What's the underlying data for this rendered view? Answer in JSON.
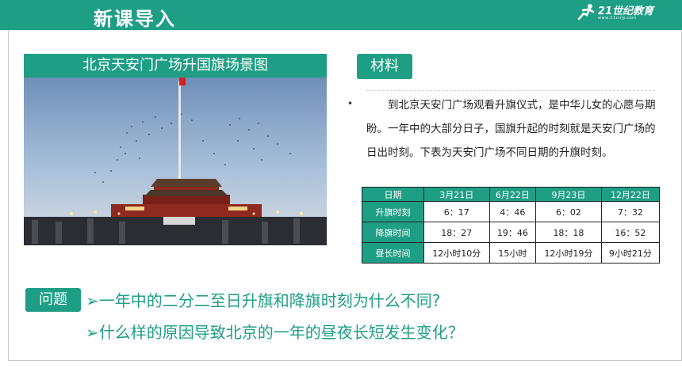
{
  "header": {
    "title": "新课导入",
    "logo_text": "21世纪教育",
    "logo_sub": "www.21cnjy.com"
  },
  "image_panel": {
    "title": "北京天安门广场升国旗场景图"
  },
  "material": {
    "tag": "材料",
    "bullet": "•",
    "text": "到北京天安门广场观看升旗仪式，是中华儿女的心愿与期盼。一年中的大部分日子，国旗升起的时刻就是天安门广场的日出时刻。下表为天安门广场不同日期的升旗时刻。"
  },
  "table": {
    "header": [
      "日期",
      "3月21日",
      "6月22日",
      "9月23日",
      "12月22日"
    ],
    "rows": [
      {
        "label": "升旗时刻",
        "values": [
          "6：17",
          "4：46",
          "6：02",
          "7：32"
        ]
      },
      {
        "label": "降旗时间",
        "values": [
          "18：27",
          "19：46",
          "18：18",
          "16：52"
        ]
      },
      {
        "label": "昼长时间",
        "values": [
          "12小时10分",
          "15小时",
          "12小时19分",
          "9小时21分"
        ]
      }
    ]
  },
  "question": {
    "tag": "问题",
    "line1": "➢一年中的二分二至日升旗和降旗时刻为什么不同?",
    "line2": "➢什么样的原因导致北京的一年的昼夜长短发生变化？"
  },
  "colors": {
    "accent": "#1f9e86"
  }
}
